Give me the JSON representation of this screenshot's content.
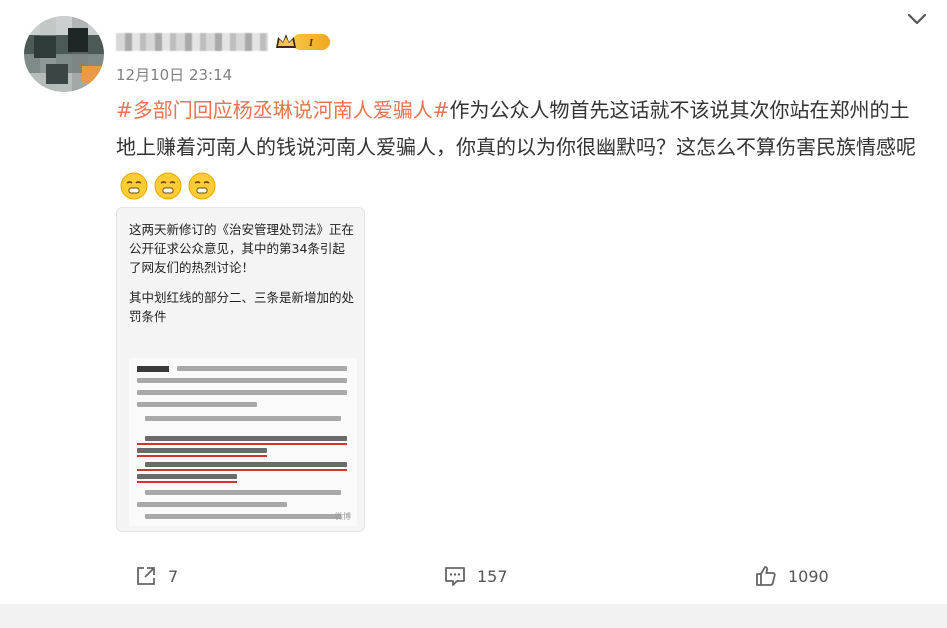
{
  "post": {
    "author": {
      "username_obscured": true,
      "avatar_obscured": true,
      "badge_icon": "vip-crown-icon",
      "badge_label": "I"
    },
    "timestamp": "12月10日 23:14",
    "hashtag": "#多部门回应杨丞琳说河南人爱骗人#",
    "body_text": "作为公众人物首先这话就不该说其次你站在郑州的土地上赚着河南人的钱说河南人爱骗人，你真的以为你很幽默吗？这怎么不算伤害民族情感呢",
    "emojis": [
      "smug-face-emoji",
      "smug-face-emoji",
      "smug-face-emoji"
    ],
    "image": {
      "paragraph1": "这两天新修订的《治安管理处罚法》正在公开征求公众意见，其中的第34条引起了网友们的热烈讨论！",
      "paragraph2": "其中划红线的部分二、三条是新增加的处罚条件",
      "watermark": "微博"
    }
  },
  "actions": {
    "repost": {
      "icon": "share-icon",
      "count": "7"
    },
    "comment": {
      "icon": "comment-icon",
      "count": "157"
    },
    "like": {
      "icon": "thumbs-up-icon",
      "count": "1090"
    }
  },
  "menu": {
    "icon": "chevron-down-icon"
  },
  "colors": {
    "hashtag": "#eb7350",
    "timestamp": "#808080",
    "body": "#333333",
    "underline": "#d0342c"
  }
}
